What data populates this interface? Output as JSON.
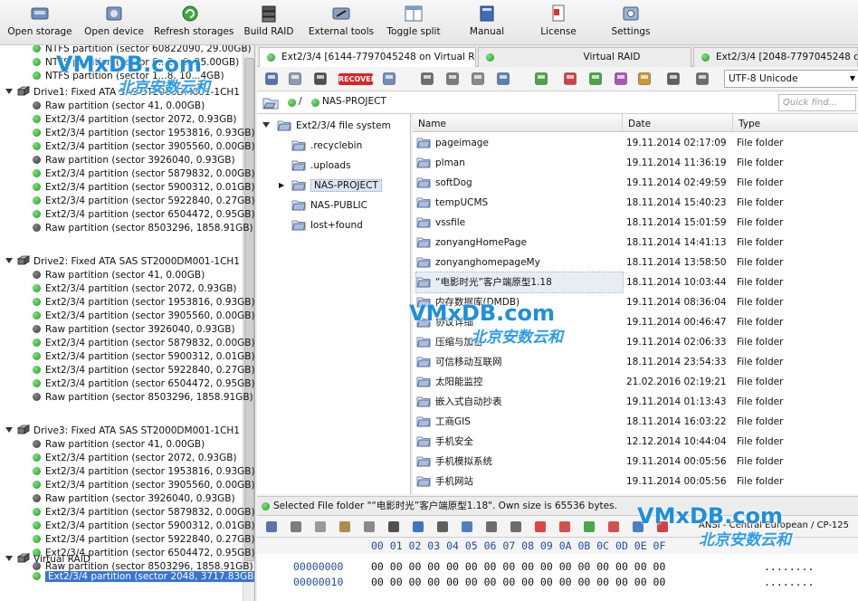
{
  "toolbar": {
    "buttons": [
      {
        "label": "Open storage",
        "icon": "open-storage-icon"
      },
      {
        "label": "Open device",
        "icon": "open-device-icon"
      },
      {
        "label": "Refresh storages",
        "icon": "refresh-icon"
      },
      {
        "label": "Build RAID",
        "icon": "build-raid-icon"
      },
      {
        "label": "External tools",
        "icon": "tools-icon"
      },
      {
        "label": "Toggle split",
        "icon": "split-icon"
      },
      {
        "label": "Manual",
        "icon": "manual-icon"
      },
      {
        "label": "License",
        "icon": "license-icon"
      },
      {
        "label": "Settings",
        "icon": "settings-icon"
      }
    ]
  },
  "left_tree": {
    "top_partitions": [
      "NTFS partition (sector 60822090, 29.00GB)",
      "NTFS partition (sector 6...2...6, 25.00GB)",
      "NTFS partition (sector 1...8, 10...4GB)"
    ],
    "drives": [
      {
        "label": "Drive1: Fixed ATA SAS ST2000DM001-1CH1",
        "partitions": [
          {
            "label": "Raw partition (sector 41, 0.00GB)",
            "status": "dark"
          },
          {
            "label": "Ext2/3/4 partition (sector 2072, 0.93GB)",
            "status": "green"
          },
          {
            "label": "Ext2/3/4 partition (sector 1953816, 0.93GB)",
            "status": "green"
          },
          {
            "label": "Ext2/3/4 partition (sector 3905560, 0.00GB)",
            "status": "green"
          },
          {
            "label": "Raw partition (sector 3926040, 0.93GB)",
            "status": "dark"
          },
          {
            "label": "Ext2/3/4 partition (sector 5879832, 0.00GB)",
            "status": "green"
          },
          {
            "label": "Ext2/3/4 partition (sector 5900312, 0.01GB)",
            "status": "green"
          },
          {
            "label": "Ext2/3/4 partition (sector 5922840, 0.27GB)",
            "status": "green"
          },
          {
            "label": "Ext2/3/4 partition (sector 6504472, 0.95GB)",
            "status": "green"
          },
          {
            "label": "Raw partition (sector 8503296, 1858.91GB)",
            "status": "dark"
          }
        ]
      },
      {
        "label": "Drive2: Fixed ATA SAS ST2000DM001-1CH1",
        "partitions": [
          {
            "label": "Raw partition (sector 41, 0.00GB)",
            "status": "dark"
          },
          {
            "label": "Ext2/3/4 partition (sector 2072, 0.93GB)",
            "status": "green"
          },
          {
            "label": "Ext2/3/4 partition (sector 1953816, 0.93GB)",
            "status": "green"
          },
          {
            "label": "Ext2/3/4 partition (sector 3905560, 0.00GB)",
            "status": "green"
          },
          {
            "label": "Raw partition (sector 3926040, 0.93GB)",
            "status": "dark"
          },
          {
            "label": "Ext2/3/4 partition (sector 5879832, 0.00GB)",
            "status": "green"
          },
          {
            "label": "Ext2/3/4 partition (sector 5900312, 0.01GB)",
            "status": "green"
          },
          {
            "label": "Ext2/3/4 partition (sector 5922840, 0.27GB)",
            "status": "green"
          },
          {
            "label": "Ext2/3/4 partition (sector 6504472, 0.95GB)",
            "status": "green"
          },
          {
            "label": "Raw partition (sector 8503296, 1858.91GB)",
            "status": "dark"
          }
        ]
      },
      {
        "label": "Drive3: Fixed ATA SAS ST2000DM001-1CH1",
        "partitions": [
          {
            "label": "Raw partition (sector 41, 0.00GB)",
            "status": "dark"
          },
          {
            "label": "Ext2/3/4 partition (sector 2072, 0.93GB)",
            "status": "green"
          },
          {
            "label": "Ext2/3/4 partition (sector 1953816, 0.93GB)",
            "status": "green"
          },
          {
            "label": "Ext2/3/4 partition (sector 3905560, 0.00GB)",
            "status": "green"
          },
          {
            "label": "Raw partition (sector 3926040, 0.93GB)",
            "status": "dark"
          },
          {
            "label": "Ext2/3/4 partition (sector 5879832, 0.00GB)",
            "status": "green"
          },
          {
            "label": "Ext2/3/4 partition (sector 5900312, 0.01GB)",
            "status": "green"
          },
          {
            "label": "Ext2/3/4 partition (sector 5922840, 0.27GB)",
            "status": "green"
          },
          {
            "label": "Ext2/3/4 partition (sector 6504472, 0.95GB)",
            "status": "green"
          },
          {
            "label": "Raw partition (sector 8503296, 1858.91GB)",
            "status": "dark"
          }
        ]
      }
    ],
    "virtual_raid": {
      "label": "Virtual RAID",
      "partition": "Ext2/3/4 partition (sector 2048, 3717.83GB)"
    }
  },
  "tabs": [
    {
      "label": "Ext2/3/4 [6144-7797045248 on Virtual R...",
      "active": true
    },
    {
      "label": "Virtual RAID",
      "active": false
    },
    {
      "label": "Ext2/3/4 [2048-7797045248 on Vi",
      "active": false
    }
  ],
  "file_toolbar": {
    "recover_label": "RECOVER",
    "encoding": "UTF-8 Unicode"
  },
  "path": {
    "root": "/",
    "current": "NAS-PROJECT",
    "quick_find_placeholder": "Quick find..."
  },
  "folder_tree": {
    "root": "Ext2/3/4 file system",
    "items": [
      ".recyclebin",
      ".uploads",
      "NAS-PROJECT",
      "NAS-PUBLIC",
      "lost+found"
    ],
    "selected": "NAS-PROJECT"
  },
  "file_list": {
    "columns": [
      "Name",
      "Date",
      "Type"
    ],
    "rows": [
      {
        "name": "pageimage",
        "date": "19.11.2014 02:17:09",
        "type": "File folder"
      },
      {
        "name": "plman",
        "date": "19.11.2014 11:36:19",
        "type": "File folder"
      },
      {
        "name": "softDog",
        "date": "19.11.2014 02:49:59",
        "type": "File folder"
      },
      {
        "name": "tempUCMS",
        "date": "18.11.2014 15:40:23",
        "type": "File folder"
      },
      {
        "name": "vssfile",
        "date": "18.11.2014 15:01:59",
        "type": "File folder"
      },
      {
        "name": "zonyangHomePage",
        "date": "18.11.2014 14:41:13",
        "type": "File folder"
      },
      {
        "name": "zonyanghomepageMy",
        "date": "18.11.2014 13:58:50",
        "type": "File folder"
      },
      {
        "name": "“电影时光”客户端原型1.18",
        "date": "18.11.2014 10:03:44",
        "type": "File folder"
      },
      {
        "name": "内存数据库(DMDB)",
        "date": "19.11.2014 08:36:04",
        "type": "File folder"
      },
      {
        "name": "协议详细",
        "date": "19.11.2014 00:46:47",
        "type": "File folder"
      },
      {
        "name": "压缩与加密",
        "date": "19.11.2014 02:06:33",
        "type": "File folder"
      },
      {
        "name": "可信移动互联网",
        "date": "18.11.2014 23:54:33",
        "type": "File folder"
      },
      {
        "name": "太阳能监控",
        "date": "21.02.2016 02:19:21",
        "type": "File folder"
      },
      {
        "name": "嵌入式自动抄表",
        "date": "19.11.2014 01:13:43",
        "type": "File folder"
      },
      {
        "name": "工商GIS",
        "date": "18.11.2014 16:03:22",
        "type": "File folder"
      },
      {
        "name": "手机安全",
        "date": "12.12.2014 10:44:04",
        "type": "File folder"
      },
      {
        "name": "手机模拟系统",
        "date": "19.11.2014 00:05:56",
        "type": "File folder"
      },
      {
        "name": "手机网站",
        "date": "19.11.2014 00:05:56",
        "type": "File folder"
      }
    ],
    "selected_index": 7
  },
  "status": {
    "text": "Selected File folder \"“电影时光”客户端原型1.18\". Own size is 65536 bytes."
  },
  "hex": {
    "encoding": "ANSI - Central European / CP-125",
    "header": "00 01 02 03 04 05 06 07 08 09 0A 0B 0C 0D 0E 0F",
    "rows": [
      {
        "offset": "00000000",
        "bytes": "00 00 00 00 00 00 00 00 00 00 00 00 00 00 00 00",
        "ascii": "........"
      },
      {
        "offset": "00000010",
        "bytes": "00 00 00 00 00 00 00 00 00 00 00 00 00 00 00 00",
        "ascii": "........"
      }
    ]
  },
  "watermarks": {
    "site": "VMxDB.com",
    "cn": "北京安数云和"
  }
}
